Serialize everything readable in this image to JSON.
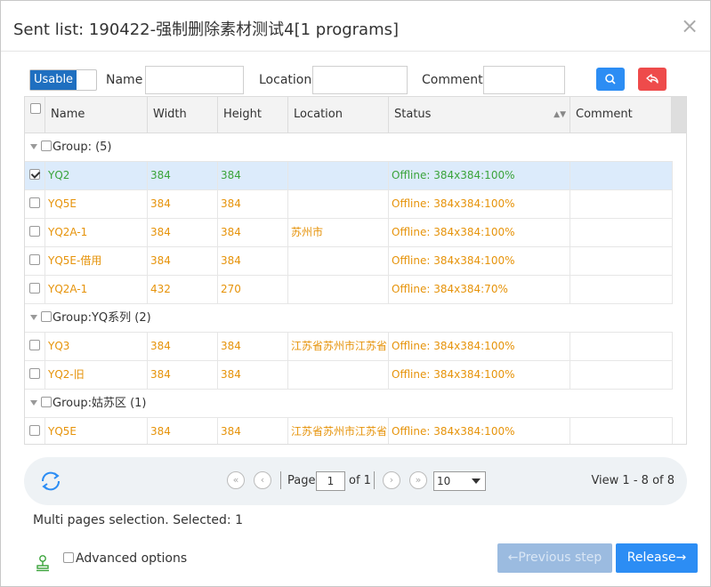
{
  "dialog": {
    "title": "Sent list: 190422-强制删除素材测试4[1 programs]",
    "close": "×"
  },
  "filter": {
    "toggle_label": "Usable",
    "name_label": "Name",
    "name_value": "",
    "location_label": "Location",
    "location_value": "",
    "comment_label": "Comment",
    "comment_value": ""
  },
  "grid": {
    "columns": [
      "Name",
      "Width",
      "Height",
      "Location",
      "Status",
      "Comment"
    ],
    "rows": [
      {
        "kind": "group",
        "label": "Group: (5)"
      },
      {
        "kind": "item",
        "checked": true,
        "color": "green",
        "name": "YQ2",
        "width": "384",
        "height": "384",
        "location": "",
        "status": "Offline: 384x384:100%",
        "comment": ""
      },
      {
        "kind": "item",
        "checked": false,
        "color": "orange",
        "name": "YQ5E",
        "width": "384",
        "height": "384",
        "location": "",
        "status": "Offline: 384x384:100%",
        "comment": ""
      },
      {
        "kind": "item",
        "checked": false,
        "color": "orange",
        "name": "YQ2A-1",
        "width": "384",
        "height": "384",
        "location": "苏州市",
        "status": "Offline: 384x384:100%",
        "comment": ""
      },
      {
        "kind": "item",
        "checked": false,
        "color": "orange",
        "name": "YQ5E-借用",
        "width": "384",
        "height": "384",
        "location": "",
        "status": "Offline: 384x384:100%",
        "comment": ""
      },
      {
        "kind": "item",
        "checked": false,
        "color": "orange",
        "name": "YQ2A-1",
        "width": "432",
        "height": "270",
        "location": "",
        "status": "Offline: 384x384:70%",
        "comment": ""
      },
      {
        "kind": "group",
        "label": "Group:YQ系列 (2)"
      },
      {
        "kind": "item",
        "checked": false,
        "color": "orange",
        "name": "YQ3",
        "width": "384",
        "height": "384",
        "location": "江苏省苏州市江苏省",
        "status": "Offline: 384x384:100%",
        "comment": ""
      },
      {
        "kind": "item",
        "checked": false,
        "color": "orange",
        "name": "YQ2-旧",
        "width": "384",
        "height": "384",
        "location": "",
        "status": "Offline: 384x384:100%",
        "comment": ""
      },
      {
        "kind": "group",
        "label": "Group:姑苏区 (1)"
      },
      {
        "kind": "item",
        "checked": false,
        "color": "orange",
        "name": "YQ5E",
        "width": "384",
        "height": "384",
        "location": "江苏省苏州市江苏省",
        "status": "Offline: 384x384:100%",
        "comment": ""
      }
    ]
  },
  "pager": {
    "page_label": "Page",
    "page_value": "1",
    "of_label": "of 1",
    "page_size": "10",
    "view_text": "View 1 - 8 of 8"
  },
  "footer": {
    "multi_text": "Multi pages selection. Selected: 1",
    "advanced_label": "Advanced options",
    "prev_label": "←Previous step",
    "release_label": "Release→"
  },
  "colors": {
    "primary": "#2c8df4",
    "danger": "#ee4b4b",
    "orange_text": "#e6930a",
    "green_text": "#3aa33a",
    "selected_row": "#dcebfb"
  }
}
